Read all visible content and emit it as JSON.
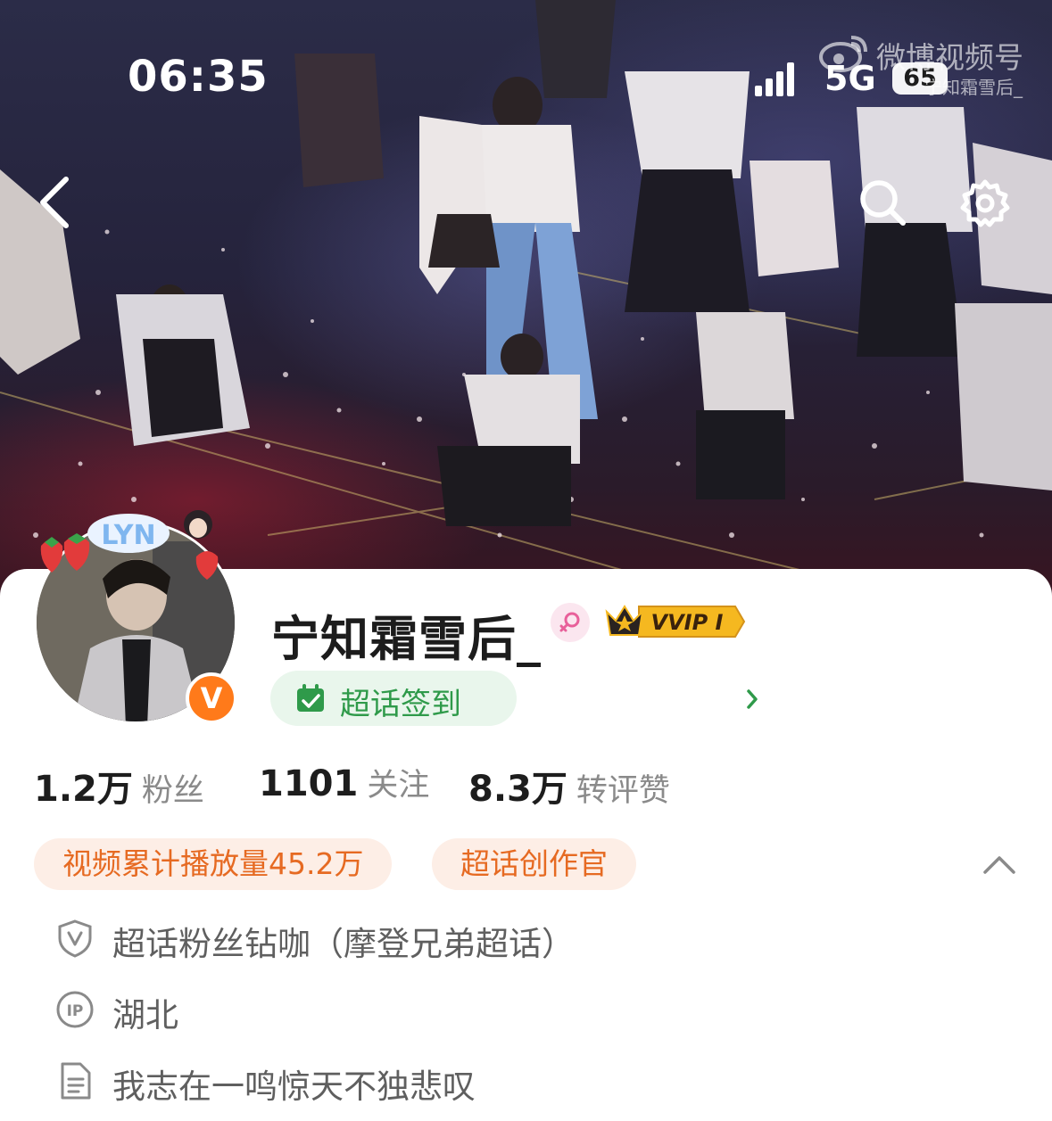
{
  "status_bar": {
    "time": "06:35",
    "network": "5G",
    "battery": "65"
  },
  "watermark": {
    "title": "微博视频号",
    "user": "宁知霜雪后_"
  },
  "nav": {
    "back_icon": "chevron-left-icon",
    "search_icon": "search-icon",
    "settings_icon": "gear-icon"
  },
  "profile": {
    "username": "宁知霜雪后_",
    "gender": "female",
    "vip_label": "VVIP I",
    "verified_icon": "V",
    "pendant_text": "LYN",
    "checkin_label": "超话签到"
  },
  "stats": [
    {
      "value": "1.2万",
      "label": "粉丝"
    },
    {
      "value": "1101",
      "label": "关注"
    },
    {
      "value": "8.3万",
      "label": "转评赞"
    }
  ],
  "tags": [
    "视频累计播放量45.2万",
    "超话创作官"
  ],
  "info": [
    {
      "icon": "shield-v-icon",
      "text": "超话粉丝钻咖（摩登兄弟超话）"
    },
    {
      "icon": "ip-icon",
      "text": "湖北"
    },
    {
      "icon": "document-icon",
      "text": "我志在一鸣惊天不独悲叹"
    }
  ],
  "colors": {
    "accent_orange": "#e66a22",
    "tag_bg": "#fdeee6",
    "checkin_green": "#2f9a4a",
    "checkin_bg": "#e9f6ec",
    "vip_gold": "#f5b820"
  }
}
